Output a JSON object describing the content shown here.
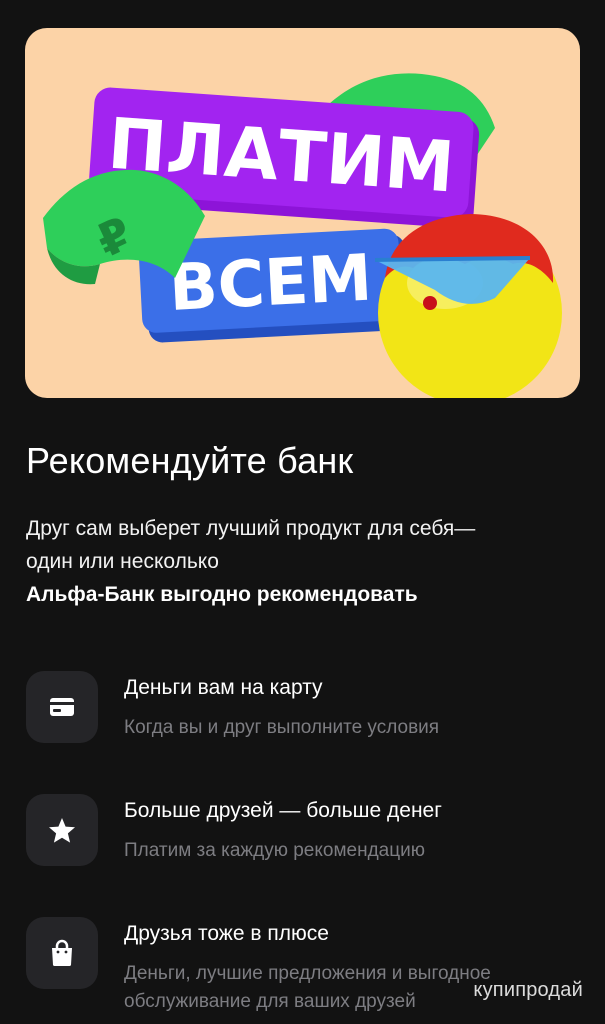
{
  "banner": {
    "line1": "ПЛАТИМ",
    "line2": "ВСЕМ",
    "colors": {
      "background": "#fcd3a7",
      "purple": "#a224f0",
      "blue": "#3b6fe8",
      "money_green": "#2ecf5a",
      "character_yellow": "#f2e516",
      "hair_red": "#e02a1e",
      "glasses_blue": "#58b6f0"
    }
  },
  "title": "Рекомендуйте банк",
  "description": {
    "line1": "Друг сам выберет лучший продукт для себя—",
    "line2": "один или несколько",
    "line3": "Альфа-Банк выгодно рекомендовать"
  },
  "features": [
    {
      "icon": "credit-card-icon",
      "title": "Деньги вам на карту",
      "subtitle": "Когда вы и друг выполните условия"
    },
    {
      "icon": "star-icon",
      "title": "Больше друзей — больше денег",
      "subtitle": "Платим за каждую рекомендацию"
    },
    {
      "icon": "shopping-bag-icon",
      "title": "Друзья тоже в плюсе",
      "subtitle": "Деньги, лучшие предложения и выгодное обслуживание для ваших друзей"
    }
  ],
  "watermark": "купипродай"
}
